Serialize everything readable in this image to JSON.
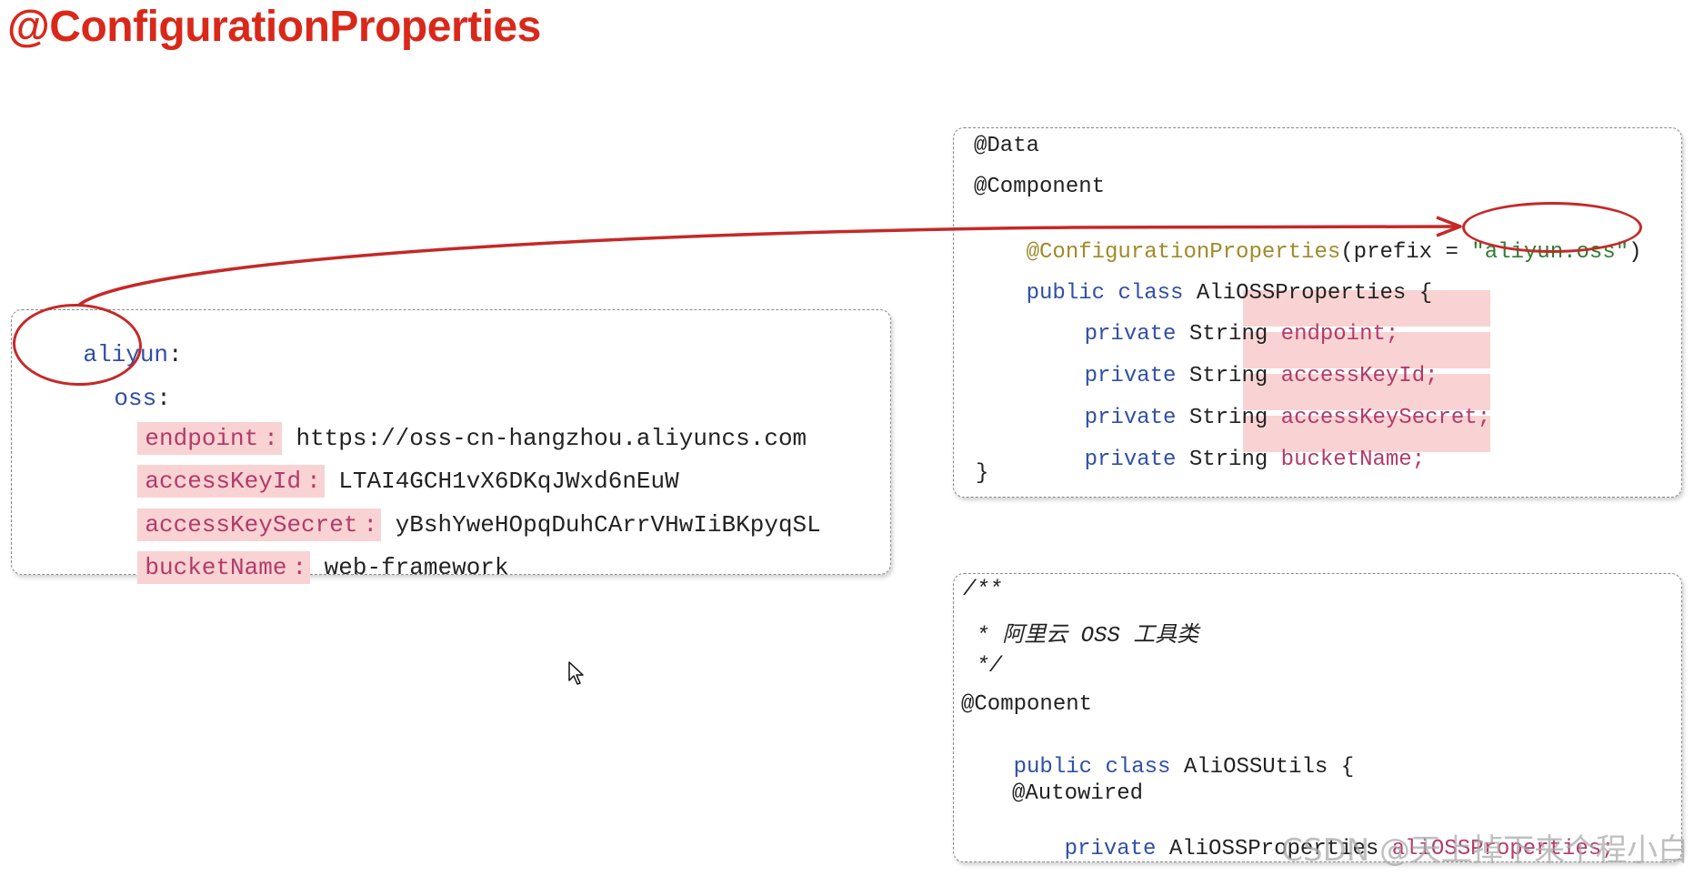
{
  "title": "@ConfigurationProperties",
  "yaml": {
    "root_key": "aliyun",
    "root_colon": ":",
    "child_key": "oss",
    "child_colon": ":",
    "entries": [
      {
        "key": "endpoint",
        "value": "https://oss-cn-hangzhou.aliyuncs.com"
      },
      {
        "key": "accessKeyId",
        "value": "LTAI4GCH1vX6DKqJWxd6nEuW"
      },
      {
        "key": "accessKeySecret",
        "value": "yBshYweHOpqDuhCArrVHwIiBKpyqSL"
      },
      {
        "key": "bucketName",
        "value": "web-framework"
      }
    ]
  },
  "properties_class": {
    "anno_data": "@Data",
    "anno_component": "@Component",
    "anno_config": "@ConfigurationProperties",
    "prefix_open": "(prefix = ",
    "prefix_value": "\"aliyun.oss\"",
    "prefix_close": ")",
    "kw_public": "public",
    "kw_class": "class",
    "class_name": "AliOSSProperties {",
    "fields": [
      {
        "modifier": "private",
        "type": "String",
        "name": "endpoint;"
      },
      {
        "modifier": "private",
        "type": "String",
        "name": "accessKeyId;"
      },
      {
        "modifier": "private",
        "type": "String",
        "name": "accessKeySecret;"
      },
      {
        "modifier": "private",
        "type": "String",
        "name": "bucketName;"
      }
    ],
    "closing": "}"
  },
  "utils_class": {
    "comment_open": "/**",
    "comment_body": " * 阿里云 OSS 工具类",
    "comment_close": " */",
    "anno_component": "@Component",
    "kw_public": "public",
    "kw_class": "class",
    "class_name": "AliOSSUtils {",
    "anno_autowired": "@Autowired",
    "field_modifier": "private",
    "field_type": "AliOSSProperties",
    "field_name": "aliOSSProperties;"
  },
  "watermark": "CSDN @天上掉下来个程小白",
  "colors": {
    "title": "#d9281a",
    "highlight": "#f9d3d3",
    "arrow": "#c62828",
    "keyword": "#2f4fa8",
    "annotation": "#a08a2a",
    "string": "#2e7d32",
    "field": "#b23a6a"
  }
}
